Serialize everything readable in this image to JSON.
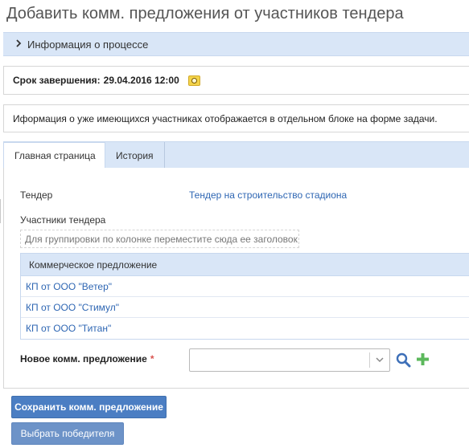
{
  "page": {
    "title": "Добавить комм. предложения от участников тендера"
  },
  "process_section": {
    "label": "Информация о процессе"
  },
  "deadline": {
    "label": "Срок завершения:",
    "value": "29.04.2016 12:00"
  },
  "info_message": "Иформация о уже имеющихся участниках отображается в отдельном блоке на форме задачи.",
  "tabs": [
    {
      "label": "Главная страница",
      "active": true
    },
    {
      "label": "История",
      "active": false
    }
  ],
  "form": {
    "tender_label": "Тендер",
    "tender_value": "Тендер на строительство стадиона",
    "participants_label": "Участники тендера",
    "group_drop_hint": "Для группировки по колонке переместите сюда ее заголовок",
    "grid": {
      "columns": [
        "Коммерческое предложение"
      ],
      "rows": [
        "КП от ООО \"Ветер\"",
        "КП от ООО \"Стимул\"",
        "КП от ООО \"Титан\""
      ]
    },
    "new_offer_label": "Новое комм. предложение",
    "required_mark": "*",
    "new_offer_value": ""
  },
  "buttons": {
    "save": "Сохранить комм. предложение",
    "choose_winner": "Выбрать победителя"
  },
  "colors": {
    "accent": "#4b7ec3",
    "link": "#2e66b3",
    "header_bg": "#d9e6f7",
    "add_green": "#5cb85c"
  }
}
